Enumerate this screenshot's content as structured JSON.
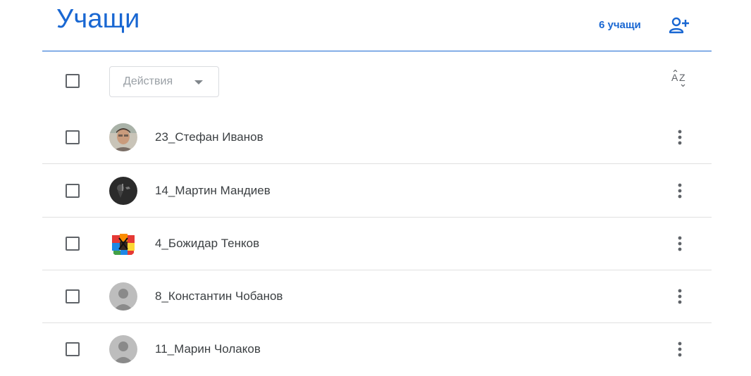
{
  "header": {
    "title": "Учащи",
    "student_count": "6 учащи",
    "invite_icon": "person-add-icon"
  },
  "toolbar": {
    "actions_label": "Действия",
    "sort_icon": "sort-az-icon",
    "sort_glyph_top": "A",
    "sort_glyph_bottom": "Z"
  },
  "students": [
    {
      "name": "23_Стефан Иванов",
      "avatar": "photo"
    },
    {
      "name": "14_Мартин Мандиев",
      "avatar": "dark-photo"
    },
    {
      "name": "4_Божидар Тенков",
      "avatar": "cube-photo"
    },
    {
      "name": "8_Константин Чобанов",
      "avatar": "default"
    },
    {
      "name": "11_Марин Чолаков",
      "avatar": "default"
    }
  ],
  "colors": {
    "accent": "#1967d2",
    "text": "#3c4043",
    "divider": "#e0e0e0",
    "placeholder_avatar": "#bdbdbd"
  }
}
